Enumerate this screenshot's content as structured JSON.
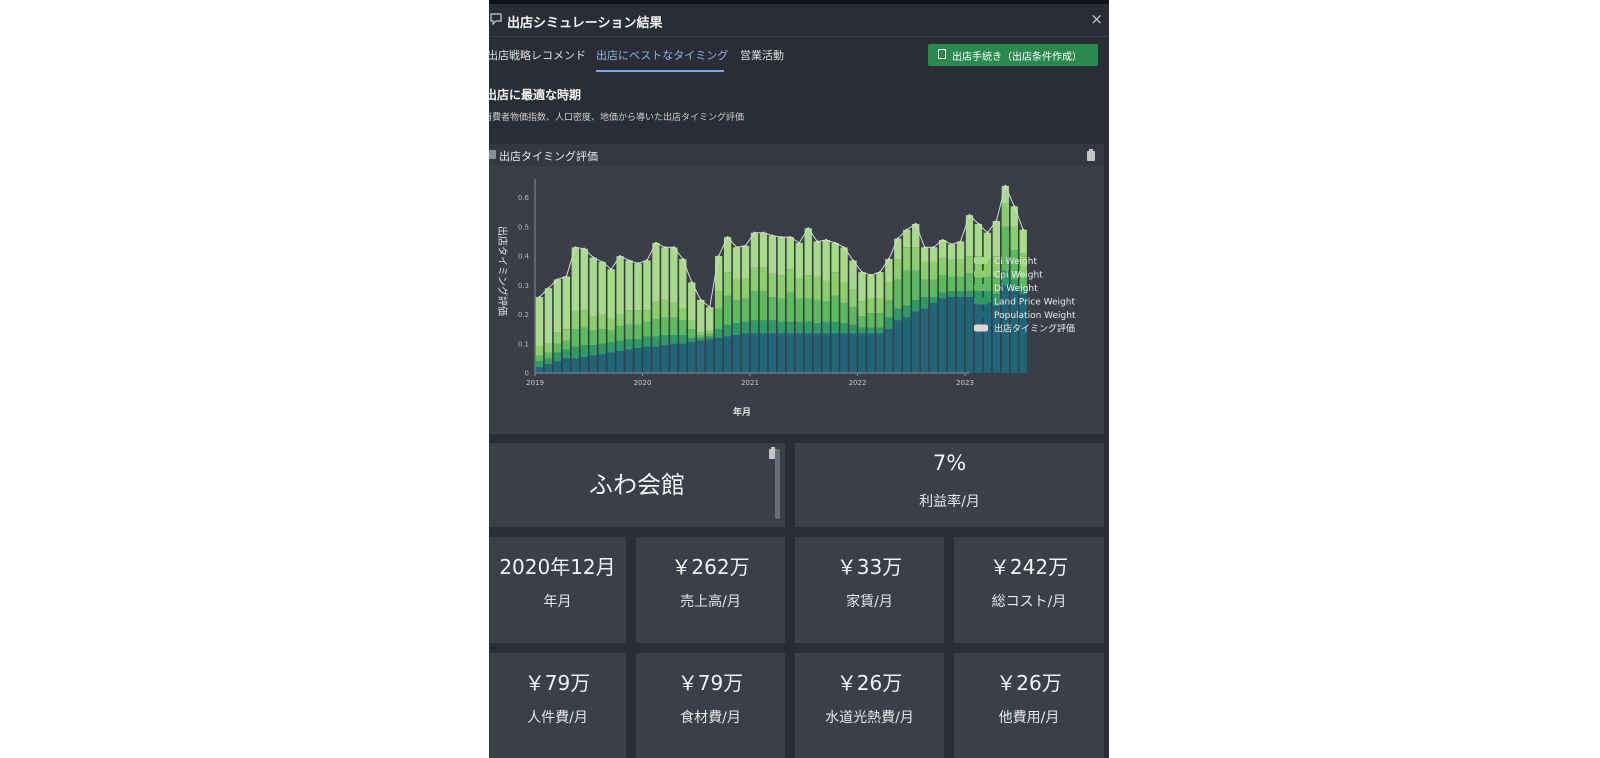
{
  "window": {
    "title": "出店シミュレーション結果",
    "close_label": "×"
  },
  "tabs": [
    {
      "label": "出店戦略レコメンド",
      "active": false
    },
    {
      "label": "出店にベストなタイミング",
      "active": true
    },
    {
      "label": "営業活動",
      "active": false
    }
  ],
  "action_button": {
    "label": "出店手続き（出店条件作成）",
    "icon": "document-icon"
  },
  "section": {
    "title": "出店に最適な時期",
    "subtitle": "消費者物価指数、人口密度、地価から導いた出店タイミング評価"
  },
  "chart_panel": {
    "title": "出店タイミング評価"
  },
  "colors": {
    "ci": "#a9d98a",
    "cpi": "#8ccd6c",
    "di": "#5dba5e",
    "land": "#2e9a66",
    "pop": "#1f6678",
    "total_line": "#d8d8d8",
    "button": "#2a8a4e",
    "active_tab": "#8fb4e8"
  },
  "chart_data": {
    "type": "bar",
    "stacked": true,
    "ylabel": "出店タイミング評価",
    "xlabel": "年月",
    "ylim": [
      0,
      0.65
    ],
    "yticks": [
      "0",
      "0.1",
      "0.2",
      "0.3",
      "0.4",
      "0.5",
      "0.6"
    ],
    "xticks": [
      "2019",
      "2020",
      "2021",
      "2022",
      "2023"
    ],
    "x_start": "2019-01",
    "legend_position": "right",
    "series": [
      {
        "name": "Population Weight",
        "values": [
          0.02,
          0.03,
          0.04,
          0.05,
          0.05,
          0.055,
          0.06,
          0.065,
          0.07,
          0.075,
          0.08,
          0.085,
          0.09,
          0.09,
          0.095,
          0.1,
          0.1,
          0.105,
          0.11,
          0.115,
          0.12,
          0.125,
          0.13,
          0.135,
          0.135,
          0.135,
          0.135,
          0.135,
          0.135,
          0.135,
          0.135,
          0.135,
          0.135,
          0.135,
          0.135,
          0.135,
          0.135,
          0.135,
          0.135,
          0.15,
          0.18,
          0.19,
          0.21,
          0.22,
          0.24,
          0.255,
          0.26,
          0.26,
          0.26,
          0.25,
          0.24,
          0.23,
          0.3,
          0.28,
          0.27
        ]
      },
      {
        "name": "Land Price Weight",
        "values": [
          0.02,
          0.02,
          0.03,
          0.03,
          0.04,
          0.04,
          0.035,
          0.035,
          0.035,
          0.035,
          0.035,
          0.03,
          0.035,
          0.035,
          0.035,
          0.03,
          0.03,
          0.015,
          0.01,
          0.01,
          0.03,
          0.04,
          0.04,
          0.04,
          0.045,
          0.045,
          0.045,
          0.04,
          0.04,
          0.04,
          0.04,
          0.035,
          0.04,
          0.04,
          0.035,
          0.03,
          0.02,
          0.02,
          0.02,
          0.04,
          0.04,
          0.04,
          0.04,
          0.04,
          0.02,
          0.02,
          0.02,
          0.02,
          0.02,
          0.03,
          0.04,
          0.04,
          0.05,
          0.04,
          0.02
        ]
      },
      {
        "name": "Di Weight",
        "values": [
          0.02,
          0.02,
          0.03,
          0.03,
          0.06,
          0.06,
          0.05,
          0.05,
          0.04,
          0.05,
          0.05,
          0.05,
          0.05,
          0.06,
          0.06,
          0.06,
          0.05,
          0.03,
          0.01,
          0.01,
          0.07,
          0.1,
          0.08,
          0.08,
          0.1,
          0.1,
          0.08,
          0.08,
          0.1,
          0.08,
          0.08,
          0.08,
          0.07,
          0.09,
          0.07,
          0.06,
          0.04,
          0.05,
          0.05,
          0.06,
          0.1,
          0.12,
          0.1,
          0.06,
          0.06,
          0.06,
          0.05,
          0.05,
          0.06,
          0.06,
          0.05,
          0.06,
          0.15,
          0.1,
          0.04
        ]
      },
      {
        "name": "Cpi Weight",
        "values": [
          0.03,
          0.03,
          0.04,
          0.04,
          0.06,
          0.06,
          0.05,
          0.05,
          0.04,
          0.04,
          0.05,
          0.05,
          0.04,
          0.06,
          0.06,
          0.05,
          0.04,
          0.03,
          0.01,
          0.01,
          0.06,
          0.08,
          0.07,
          0.07,
          0.08,
          0.08,
          0.08,
          0.08,
          0.08,
          0.07,
          0.08,
          0.08,
          0.07,
          0.08,
          0.07,
          0.06,
          0.05,
          0.05,
          0.05,
          0.06,
          0.07,
          0.08,
          0.08,
          0.06,
          0.06,
          0.06,
          0.06,
          0.06,
          0.06,
          0.06,
          0.06,
          0.07,
          0.08,
          0.08,
          0.08
        ]
      },
      {
        "name": "Ci Weight",
        "values": [
          0.17,
          0.19,
          0.18,
          0.18,
          0.22,
          0.21,
          0.2,
          0.18,
          0.17,
          0.2,
          0.17,
          0.16,
          0.17,
          0.2,
          0.18,
          0.19,
          0.17,
          0.13,
          0.11,
          0.08,
          0.12,
          0.12,
          0.11,
          0.11,
          0.12,
          0.12,
          0.13,
          0.13,
          0.11,
          0.12,
          0.16,
          0.12,
          0.14,
          0.1,
          0.12,
          0.1,
          0.1,
          0.08,
          0.09,
          0.08,
          0.07,
          0.06,
          0.08,
          0.05,
          0.05,
          0.06,
          0.05,
          0.06,
          0.14,
          0.11,
          0.09,
          0.12,
          0.06,
          0.07,
          0.08
        ]
      }
    ],
    "total_name": "出店タイミング評価"
  },
  "store_card": {
    "name": "ふわ会館"
  },
  "profit_card": {
    "value": "7%",
    "label": "利益率/月"
  },
  "metrics_row1": [
    {
      "value": "2020年12月",
      "label": "年月"
    },
    {
      "value": "￥262万",
      "label": "売上高/月"
    },
    {
      "value": "￥33万",
      "label": "家賃/月"
    },
    {
      "value": "￥242万",
      "label": "総コスト/月"
    }
  ],
  "metrics_row2": [
    {
      "value": "￥79万",
      "label": "人件費/月"
    },
    {
      "value": "￥79万",
      "label": "食材費/月"
    },
    {
      "value": "￥26万",
      "label": "水道光熱費/月"
    },
    {
      "value": "￥26万",
      "label": "他費用/月"
    }
  ]
}
